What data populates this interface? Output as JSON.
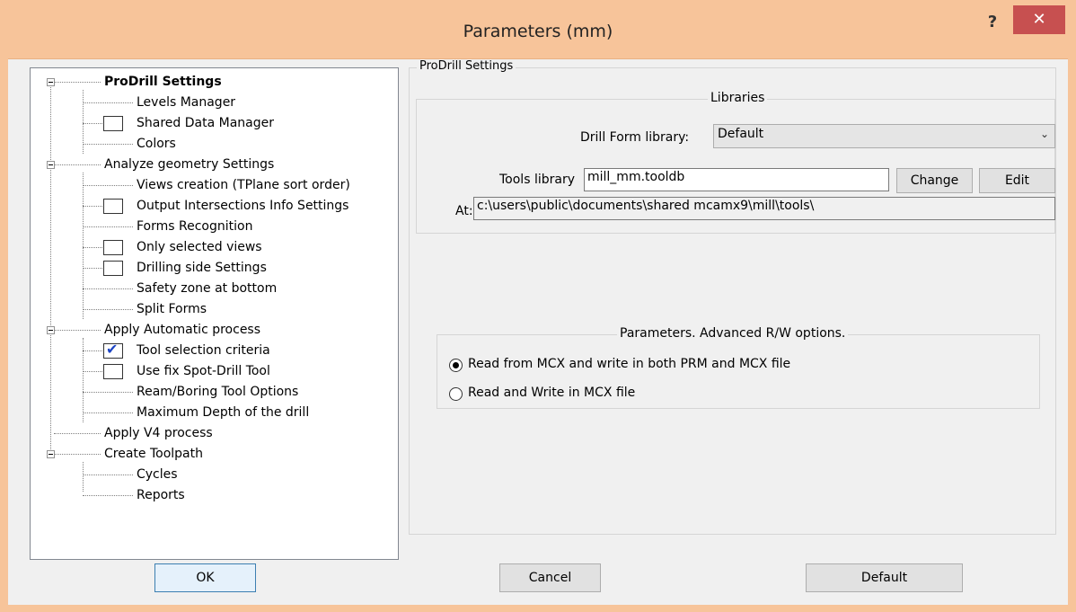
{
  "window": {
    "title": "Parameters (mm)",
    "help_glyph": "?",
    "close_glyph": "✕"
  },
  "tree": [
    {
      "label": "ProDrill Settings",
      "bold": true
    },
    {
      "label": "Levels Manager"
    },
    {
      "label": "Shared Data Manager",
      "checkbox": "unchecked"
    },
    {
      "label": "Colors"
    },
    {
      "label": "Analyze geometry Settings"
    },
    {
      "label": "Views creation (TPlane sort order)"
    },
    {
      "label": "Output Intersections Info Settings",
      "checkbox": "unchecked"
    },
    {
      "label": "Forms Recognition"
    },
    {
      "label": "Only selected views",
      "checkbox": "unchecked"
    },
    {
      "label": "Drilling side Settings",
      "checkbox": "unchecked"
    },
    {
      "label": "Safety zone at bottom"
    },
    {
      "label": "Split Forms"
    },
    {
      "label": "Apply Automatic process"
    },
    {
      "label": "Tool selection criteria",
      "checkbox": "checked"
    },
    {
      "label": "Use fix Spot-Drill Tool",
      "checkbox": "unchecked"
    },
    {
      "label": "Ream/Boring Tool Options"
    },
    {
      "label": "Maximum Depth of the drill"
    },
    {
      "label": "Apply V4 process"
    },
    {
      "label": "Create Toolpath"
    },
    {
      "label": "Cycles"
    },
    {
      "label": "Reports"
    }
  ],
  "check_glyph": "✔",
  "panel": {
    "title": "ProDrill Settings",
    "libraries": {
      "title": "Libraries",
      "drill_form_label": "Drill Form library:",
      "drill_form_value": "Default",
      "tools_label": "Tools library",
      "tools_value": "mill_mm.tooldb",
      "change_button": "Change",
      "edit_button": "Edit",
      "at_label": "At:",
      "at_value": "c:\\users\\public\\documents\\shared mcamx9\\mill\\tools\\"
    },
    "advanced": {
      "title": "Parameters. Advanced R/W options.",
      "options": [
        {
          "label": "Read from MCX and write in both PRM and MCX file",
          "selected": true
        },
        {
          "label": "Read and Write in MCX file",
          "selected": false
        }
      ]
    }
  },
  "buttons": {
    "ok": "OK",
    "cancel": "Cancel",
    "default": "Default"
  }
}
